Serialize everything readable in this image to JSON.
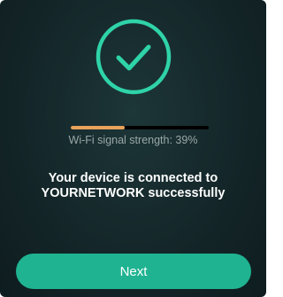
{
  "status_icon": {
    "name": "checkmark-circle-icon",
    "color": "#2fd3a8"
  },
  "signal": {
    "label": "Wi-Fi signal strength: 39%",
    "strength_percent": 39,
    "bar_color": "#e8a25a",
    "track_color": "#000000"
  },
  "message": {
    "line1": "Your device is connected to",
    "line2": "YOURNETWORK successfully"
  },
  "next_button": {
    "label": "Next",
    "color": "#1fb391"
  }
}
